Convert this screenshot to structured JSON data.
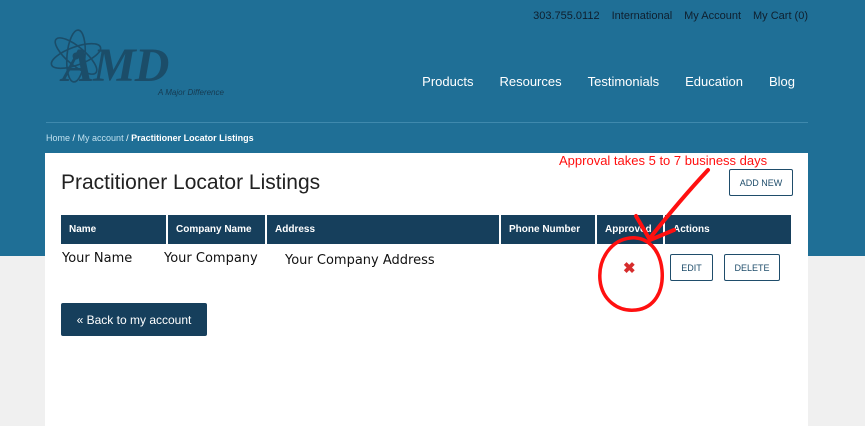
{
  "header": {
    "phone": "303.755.0112",
    "international": "International",
    "my_account": "My Account",
    "my_cart": "My Cart (0)"
  },
  "logo": {
    "wordmark": "AMD",
    "tagline": "A Major Difference"
  },
  "nav": {
    "items": [
      "Products",
      "Resources",
      "Testimonials",
      "Education",
      "Blog"
    ]
  },
  "breadcrumb": {
    "home": "Home",
    "my_account": "My account",
    "current": "Practitioner Locator Listings"
  },
  "page": {
    "title": "Practitioner Locator Listings",
    "add_new": "ADD NEW",
    "back_label": "« Back to my account"
  },
  "table": {
    "headers": [
      "Name",
      "Company Name",
      "Address",
      "Phone Number",
      "Approved",
      "Actions"
    ],
    "rows": [
      {
        "name": "Your Name",
        "company": "Your Company",
        "address": "Your Company Address",
        "phone": "",
        "approved_mark": "✖",
        "edit_label": "EDIT",
        "delete_label": "DELETE"
      }
    ]
  },
  "annotation": {
    "text": "Approval takes 5 to 7 business days"
  },
  "colors": {
    "banner": "#1f6f96",
    "header_dark": "#163f5c",
    "annotation_red": "#ff1010"
  }
}
